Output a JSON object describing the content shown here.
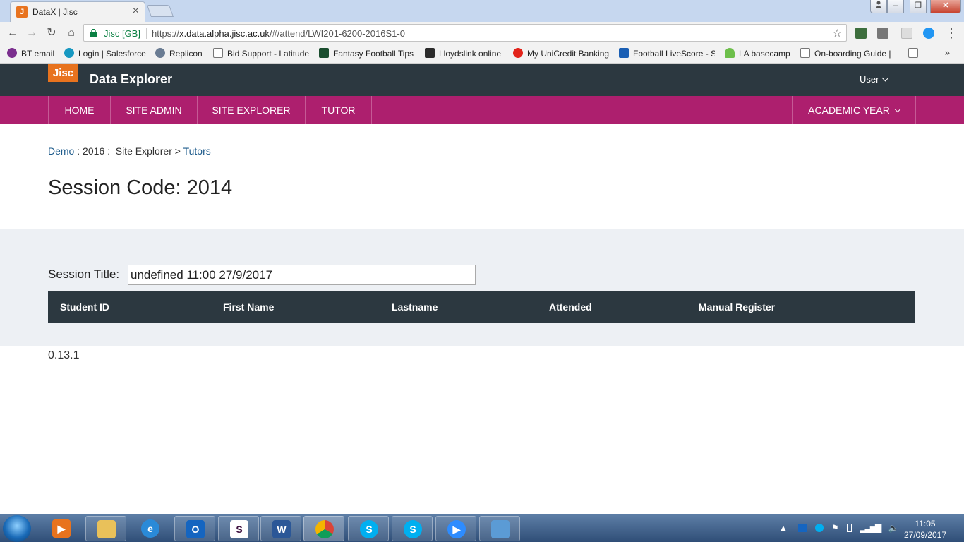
{
  "browser": {
    "tab_title": "DataX | Jisc",
    "tab_favicon_letter": "J",
    "tab_close": "×",
    "secure_label": "Jisc [GB]",
    "url_scheme": "https://",
    "url_host": "x.data.alpha.jisc.ac.uk",
    "url_path": "/#/attend/LWI201-6200-2016S1-0",
    "window_min": "–",
    "window_max": "▫",
    "window_restore": "❐",
    "window_close": "✕",
    "bookmarks_more": "»",
    "bookmarks": [
      {
        "label": "BT email",
        "color": "#7b2f8e"
      },
      {
        "label": "Login | Salesforce",
        "color": "#1798c1"
      },
      {
        "label": "Replicon",
        "color": "#6a7c93"
      },
      {
        "label": "Bid Support - Latitude",
        "color": "#ffffff"
      },
      {
        "label": "Fantasy Football Tips",
        "color": "#1a4d2e"
      },
      {
        "label": "Lloydslink online",
        "color": "#2b2b2b"
      },
      {
        "label": "My UniCredit Banking",
        "color": "#e2231a"
      },
      {
        "label": "Football LiveScore - S",
        "color": "#1b5fb4"
      },
      {
        "label": "LA basecamp",
        "color": "#6dbf4b"
      },
      {
        "label": "On-boarding Guide |",
        "color": "#ffffff"
      }
    ]
  },
  "app": {
    "logo_text": "Jisc",
    "title": "Data Explorer",
    "user_menu": "User",
    "accent_color": "#ad1f6e",
    "header_color": "#2c3840"
  },
  "nav": {
    "home": "HOME",
    "site_admin": "SITE ADMIN",
    "site_explorer": "SITE EXPLORER",
    "tutor": "TUTOR",
    "academic_year": "ACADEMIC YEAR"
  },
  "breadcrumb": {
    "demo": "Demo",
    "year": " : 2016 : ",
    "site_explorer": "Site Explorer",
    "sep": " > ",
    "tutors": "Tutors"
  },
  "page": {
    "title": "Session Code: 2014",
    "session_title_label": "Session Title:",
    "session_title_value": "undefined 11:00 27/9/2017"
  },
  "table": {
    "columns": [
      "Student ID",
      "First Name",
      "Lastname",
      "Attended",
      "Manual Register"
    ],
    "rows": []
  },
  "footer": {
    "version": "0.13.1"
  },
  "taskbar": {
    "items": [
      {
        "name": "media-player",
        "color": "#e8731e",
        "glyph": "▶"
      },
      {
        "name": "file-explorer",
        "color": "#e9c15a",
        "glyph": ""
      },
      {
        "name": "internet-explorer",
        "color": "#2a8ad8",
        "glyph": "e"
      },
      {
        "name": "outlook",
        "color": "#1565c0",
        "glyph": "O"
      },
      {
        "name": "slack",
        "color": "#ffffff",
        "glyph": "S"
      },
      {
        "name": "word",
        "color": "#2b5797",
        "glyph": "W"
      },
      {
        "name": "chrome",
        "color": "#db4437",
        "glyph": ""
      },
      {
        "name": "skype",
        "color": "#00aff0",
        "glyph": "S"
      },
      {
        "name": "skype-business",
        "color": "#00aff0",
        "glyph": "S"
      },
      {
        "name": "zoom",
        "color": "#2d8cff",
        "glyph": "▶"
      },
      {
        "name": "photos",
        "color": "#5b9bd5",
        "glyph": ""
      }
    ],
    "tray_text": "▲",
    "time": "11:05",
    "date": "27/09/2017"
  }
}
